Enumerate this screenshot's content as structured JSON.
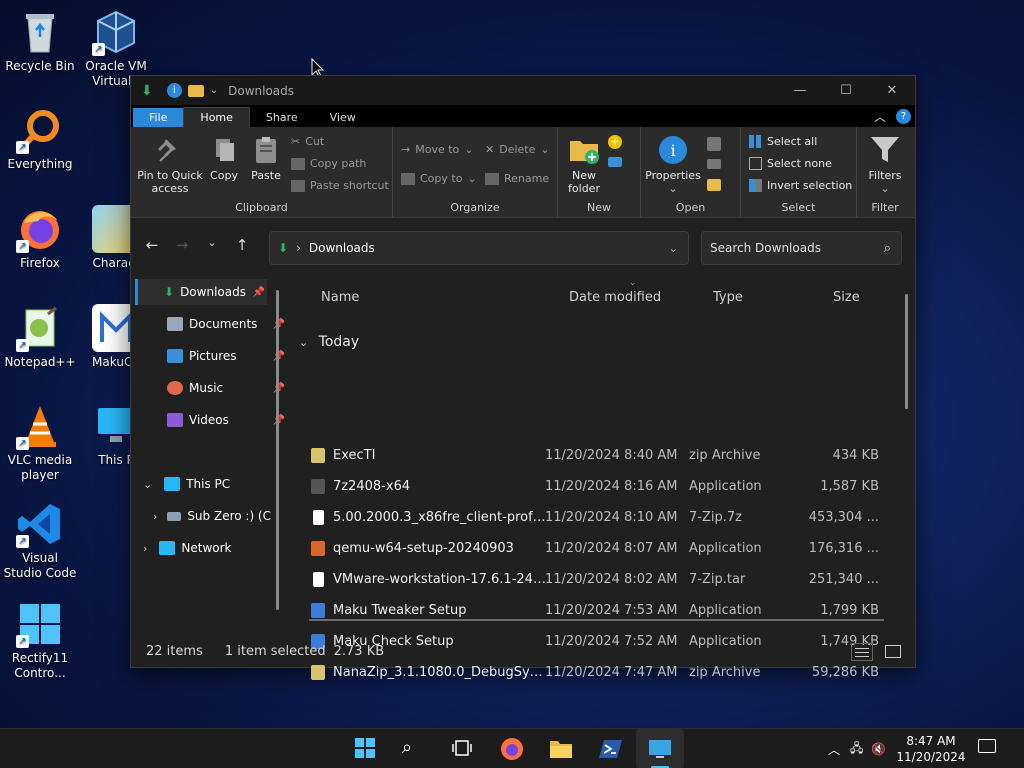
{
  "desktop": {
    "icons": [
      {
        "label": "Recycle Bin",
        "icon": "recycle-bin-icon"
      },
      {
        "label": "Oracle VM VirtualB",
        "icon": "virtualbox-icon"
      },
      {
        "label": "Everything",
        "icon": "everything-search-icon"
      },
      {
        "label": "Firefox",
        "icon": "firefox-icon"
      },
      {
        "label": "Charact",
        "icon": "character-map-icon"
      },
      {
        "label": "Notepad++",
        "icon": "notepadpp-icon"
      },
      {
        "label": "MakuCh",
        "icon": "maku-icon"
      },
      {
        "label": "VLC media player",
        "icon": "vlc-icon"
      },
      {
        "label": "This P",
        "icon": "this-pc-icon"
      },
      {
        "label": "Visual Studio Code",
        "icon": "vscode-icon"
      },
      {
        "label": "Rectify11 Contro...",
        "icon": "rectify11-icon"
      }
    ]
  },
  "window": {
    "title": "Downloads",
    "menu_tabs": {
      "file": "File",
      "home": "Home",
      "share": "Share",
      "view": "View"
    },
    "help_glyph": "?",
    "ribbon": {
      "clipboard": {
        "pin": "Pin to Quick access",
        "copy": "Copy",
        "paste": "Paste",
        "cut": "Cut",
        "copy_path": "Copy path",
        "paste_shortcut": "Paste shortcut",
        "label": "Clipboard"
      },
      "organize": {
        "move_to": "Move to",
        "copy_to": "Copy to",
        "delete": "Delete",
        "rename": "Rename",
        "label": "Organize"
      },
      "new": {
        "new_folder": "New folder",
        "label": "New"
      },
      "open": {
        "properties": "Properties",
        "label": "Open"
      },
      "select": {
        "select_all": "Select all",
        "select_none": "Select none",
        "invert_selection": "Invert selection",
        "label": "Select"
      },
      "filter": {
        "filters": "Filters",
        "label": "Filter"
      }
    },
    "address": {
      "path": "Downloads",
      "separator": "›"
    },
    "search": {
      "placeholder": "Search Downloads"
    },
    "nav": {
      "quick": [
        {
          "label": "Downloads",
          "icon": "download-icon",
          "color": "#2fb56b"
        },
        {
          "label": "Documents",
          "icon": "documents-icon",
          "color": "#9aa7b8"
        },
        {
          "label": "Pictures",
          "icon": "pictures-icon",
          "color": "#3a8fd8"
        },
        {
          "label": "Music",
          "icon": "music-icon",
          "color": "#e0684b"
        },
        {
          "label": "Videos",
          "icon": "videos-icon",
          "color": "#8b5cd6"
        }
      ],
      "this_pc": "This PC",
      "drive": "Sub Zero :) (C",
      "network": "Network"
    },
    "columns": {
      "name": "Name",
      "date": "Date modified",
      "type": "Type",
      "size": "Size"
    },
    "group_label": "Today",
    "files": [
      {
        "name": "ExecTI",
        "date": "11/20/2024 8:40 AM",
        "type": "zip Archive",
        "size": "434 KB",
        "icon": "zip-icon",
        "color": "#d9c36a"
      },
      {
        "name": "7z2408-x64",
        "date": "11/20/2024 8:16 AM",
        "type": "Application",
        "size": "1,587 KB",
        "icon": "7zip-icon",
        "color": "#555555"
      },
      {
        "name": "5.00.2000.3_x86fre_client-professi...",
        "date": "11/20/2024 8:10 AM",
        "type": "7-Zip.7z",
        "size": "453,304 ...",
        "icon": "file-icon",
        "color": "#ffffff"
      },
      {
        "name": "qemu-w64-setup-20240903",
        "date": "11/20/2024 8:07 AM",
        "type": "Application",
        "size": "176,316 ...",
        "icon": "qemu-icon",
        "color": "#d9652b"
      },
      {
        "name": "VMware-workstation-17.6.1-2431...",
        "date": "11/20/2024 8:02 AM",
        "type": "7-Zip.tar",
        "size": "251,340 ...",
        "icon": "file-icon",
        "color": "#ffffff"
      },
      {
        "name": "Maku Tweaker Setup",
        "date": "11/20/2024 7:53 AM",
        "type": "Application",
        "size": "1,799 KB",
        "icon": "maku-setup-icon",
        "color": "#3b7dd8"
      },
      {
        "name": "Maku Check Setup",
        "date": "11/20/2024 7:52 AM",
        "type": "Application",
        "size": "1,749 KB",
        "icon": "maku-setup-icon",
        "color": "#3b7dd8"
      },
      {
        "name": "NanaZip_3.1.1080.0_DebugSymbols",
        "date": "11/20/2024 7:47 AM",
        "type": "zip Archive",
        "size": "59,286 KB",
        "icon": "zip-icon",
        "color": "#d9c36a"
      }
    ],
    "status": {
      "items": "22 items",
      "selected": "1 item selected",
      "size": "2.73 KB"
    }
  },
  "taskbar": {
    "clock_time": "8:47 AM",
    "clock_date": "11/20/2024"
  }
}
